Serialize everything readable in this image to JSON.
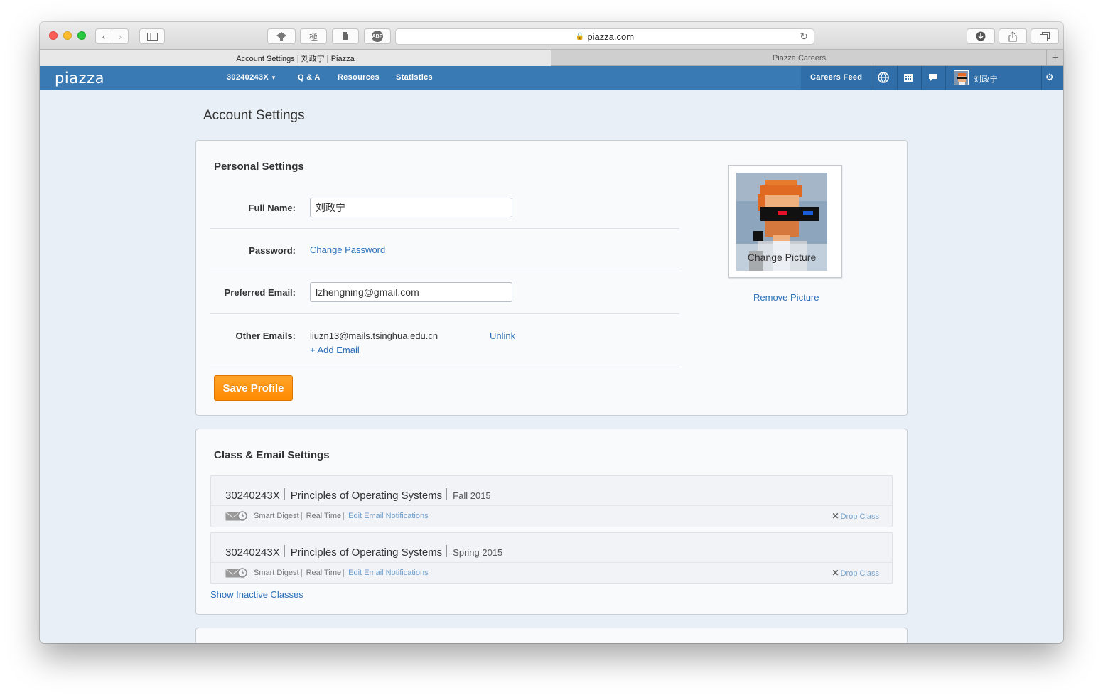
{
  "browser": {
    "url": "piazza.com",
    "tabs": [
      {
        "label": "Account Settings | 刘政宁 | Piazza",
        "active": true
      },
      {
        "label": "Piazza Careers",
        "active": false
      }
    ],
    "toolbar_buttons": [
      "back-icon",
      "forward-icon",
      "sidebar-icon",
      "bookmark-icon",
      "dict-extension",
      "hand-icon",
      "adblock-icon",
      "download-icon",
      "share-icon",
      "tabs-icon"
    ],
    "ext_dict_label": "極",
    "adblock_label": "ABP"
  },
  "nav": {
    "logo": "piazza",
    "class_menu": "30240243X",
    "links": [
      "Q & A",
      "Resources",
      "Statistics"
    ],
    "careers": "Careers Feed",
    "user_name": "刘政宁",
    "accent": "#3a7ab4"
  },
  "page": {
    "title": "Account Settings"
  },
  "personal": {
    "title": "Personal Settings",
    "full_name_label": "Full Name:",
    "full_name_value": "刘政宁",
    "password_label": "Password:",
    "change_password": "Change Password",
    "email_label": "Preferred Email:",
    "email_value": "lzhengning@gmail.com",
    "other_label": "Other Emails:",
    "other_email": "liuzn13@mails.tsinghua.edu.cn",
    "unlink": "Unlink",
    "add_email": "+ Add Email",
    "save": "Save Profile",
    "change_picture": "Change Picture",
    "remove_picture": "Remove Picture"
  },
  "classes": {
    "title": "Class & Email Settings",
    "items": [
      {
        "number": "30240243X",
        "name": "Principles of Operating Systems",
        "term": "Fall 2015",
        "digest": "Smart Digest",
        "realtime": "Real Time",
        "edit": "Edit Email Notifications",
        "drop": "Drop Class"
      },
      {
        "number": "30240243X",
        "name": "Principles of Operating Systems",
        "term": "Spring 2015",
        "digest": "Smart Digest",
        "realtime": "Real Time",
        "edit": "Edit Email Notifications",
        "drop": "Drop Class"
      }
    ],
    "show_inactive": "Show Inactive Classes"
  }
}
